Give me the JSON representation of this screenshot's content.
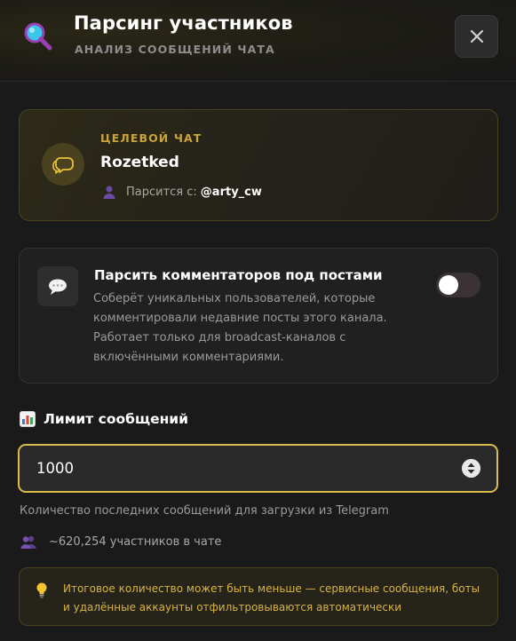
{
  "header": {
    "title": "Парсинг участников",
    "subtitle": "АНАЛИЗ СООБЩЕНИЙ ЧАТА",
    "icon": "magnifier-icon",
    "close_icon": "close-icon"
  },
  "target": {
    "label": "ЦЕЛЕВОЙ ЧАТ",
    "name": "Rozetked",
    "parsed_by_label": "Парсится с:",
    "parsed_by_handle": "@arty_cw",
    "avatar_icon": "chat-bubble-icon"
  },
  "comments_option": {
    "title": "Парсить комментаторов под постами",
    "description": "Соберёт уникальных пользователей, которые комментировали недавние посты этого канала. Работает только для broadcast-каналов с включёнными комментариями.",
    "enabled": false,
    "icon": "speech-balloon-icon"
  },
  "limit": {
    "heading": "Лимит сообщений",
    "value": "1000",
    "hint": "Количество последних сообщений для загрузки из Telegram",
    "icon": "bar-chart-icon"
  },
  "members": {
    "text": "~620,254 участников в чате",
    "icon": "people-icon"
  },
  "warning": {
    "text": "Итоговое количество может быть меньше — сервисные сообщения, боты и удалённые аккаунты отфильтровываются автоматически",
    "icon": "light-bulb-icon"
  },
  "colors": {
    "accent": "#d9bd4a",
    "accent_text": "#c9a43a",
    "background": "#1a1a1a"
  }
}
